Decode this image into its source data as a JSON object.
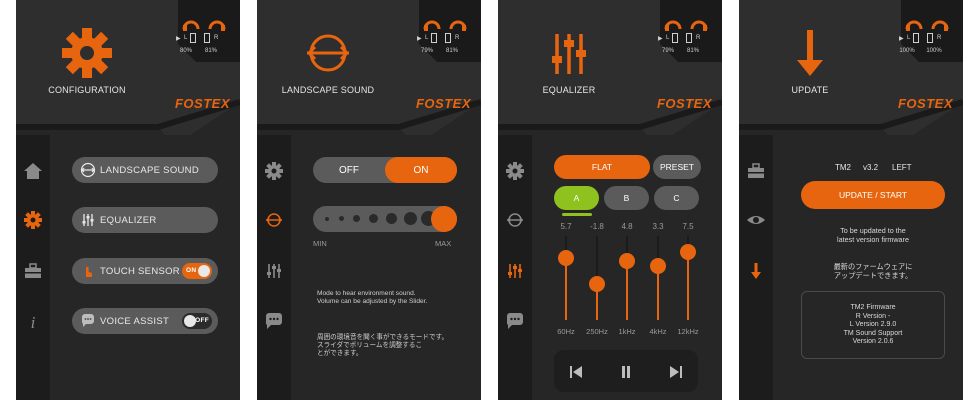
{
  "colors": {
    "accent": "#e8650f",
    "background": "#262626",
    "pill": "#5b5b5b",
    "green": "#8fc21f"
  },
  "brand": "FOSTEX",
  "screens": [
    {
      "title": "CONFIGURATION",
      "header_icon": "gear-icon",
      "battery": {
        "left_label": "L",
        "right_label": "R",
        "left_pct": "80%",
        "right_pct": "81%"
      },
      "rail": [
        {
          "icon": "home-icon",
          "active": false
        },
        {
          "icon": "gear-icon",
          "active": true
        },
        {
          "icon": "toolbox-icon",
          "active": false
        },
        {
          "icon": "info-icon",
          "active": false
        }
      ],
      "menu": [
        {
          "label": "LANDSCAPE SOUND",
          "icon": "landscape-sound-icon"
        },
        {
          "label": "EQUALIZER",
          "icon": "equalizer-icon"
        },
        {
          "label": "TOUCH SENSOR",
          "icon": "touch-icon",
          "toggle": "ON"
        },
        {
          "label": "VOICE ASSIST",
          "icon": "chat-icon",
          "toggle": "OFF"
        }
      ]
    },
    {
      "title": "LANDSCAPE SOUND",
      "header_icon": "landscape-sound-icon",
      "battery": {
        "left_label": "L",
        "right_label": "R",
        "left_pct": "79%",
        "right_pct": "81%"
      },
      "rail": [
        {
          "icon": "gear-icon",
          "active": false
        },
        {
          "icon": "landscape-sound-icon",
          "active": true
        },
        {
          "icon": "equalizer-icon",
          "active": false
        },
        {
          "icon": "chat-icon",
          "active": false
        }
      ],
      "switch": {
        "off": "OFF",
        "on": "ON",
        "selected": "ON"
      },
      "slider": {
        "min": "MIN",
        "max": "MAX",
        "level": 1.0
      },
      "desc_en": [
        "Mode to hear environment sound.",
        "Volume can be adjusted by the Slider."
      ],
      "desc_ja": [
        "周囲の環境音を聞く事ができるモードです。",
        "スライダでボリュームを調整するこ",
        "とができます。"
      ]
    },
    {
      "title": "EQUALIZER",
      "header_icon": "equalizer-icon",
      "battery": {
        "left_label": "L",
        "right_label": "R",
        "left_pct": "79%",
        "right_pct": "81%"
      },
      "rail": [
        {
          "icon": "gear-icon",
          "active": false
        },
        {
          "icon": "landscape-sound-icon",
          "active": false
        },
        {
          "icon": "equalizer-icon",
          "active": true
        },
        {
          "icon": "chat-icon",
          "active": false
        }
      ],
      "buttons": {
        "flat": "FLAT",
        "preset": "PRESET"
      },
      "presets": [
        "A",
        "B",
        "C"
      ],
      "selected_preset": "A",
      "bands": [
        {
          "freq": "60Hz",
          "value": "5.7",
          "level": 5.7
        },
        {
          "freq": "250Hz",
          "value": "-1.8",
          "level": -1.8
        },
        {
          "freq": "1kHz",
          "value": "4.8",
          "level": 4.8
        },
        {
          "freq": "4kHz",
          "value": "3.3",
          "level": 3.3
        },
        {
          "freq": "12kHz",
          "value": "7.5",
          "level": 7.5
        }
      ],
      "player": [
        "previous-icon",
        "pause-icon",
        "next-icon"
      ]
    },
    {
      "title": "UPDATE",
      "header_icon": "download-arrow-icon",
      "battery": {
        "left_label": "L",
        "right_label": "R",
        "left_pct": "100%",
        "right_pct": "100%"
      },
      "rail": [
        {
          "icon": "toolbox-icon",
          "active": false
        },
        {
          "icon": "eye-icon",
          "active": false
        },
        {
          "icon": "download-arrow-icon",
          "active": true
        }
      ],
      "device": {
        "model": "TM2",
        "version": "v3.2",
        "side": "LEFT"
      },
      "update_button": "UPDATE / START",
      "note_en": [
        "To be updated to the",
        "latest version firmware"
      ],
      "note_ja": [
        "最新のファームウェアに",
        "アップデートできます。"
      ],
      "firmware": [
        "TM2 Firmware",
        "R Version -",
        "L Version 2.9.0",
        "TM Sound Support",
        "Version 2.0.6"
      ]
    }
  ]
}
